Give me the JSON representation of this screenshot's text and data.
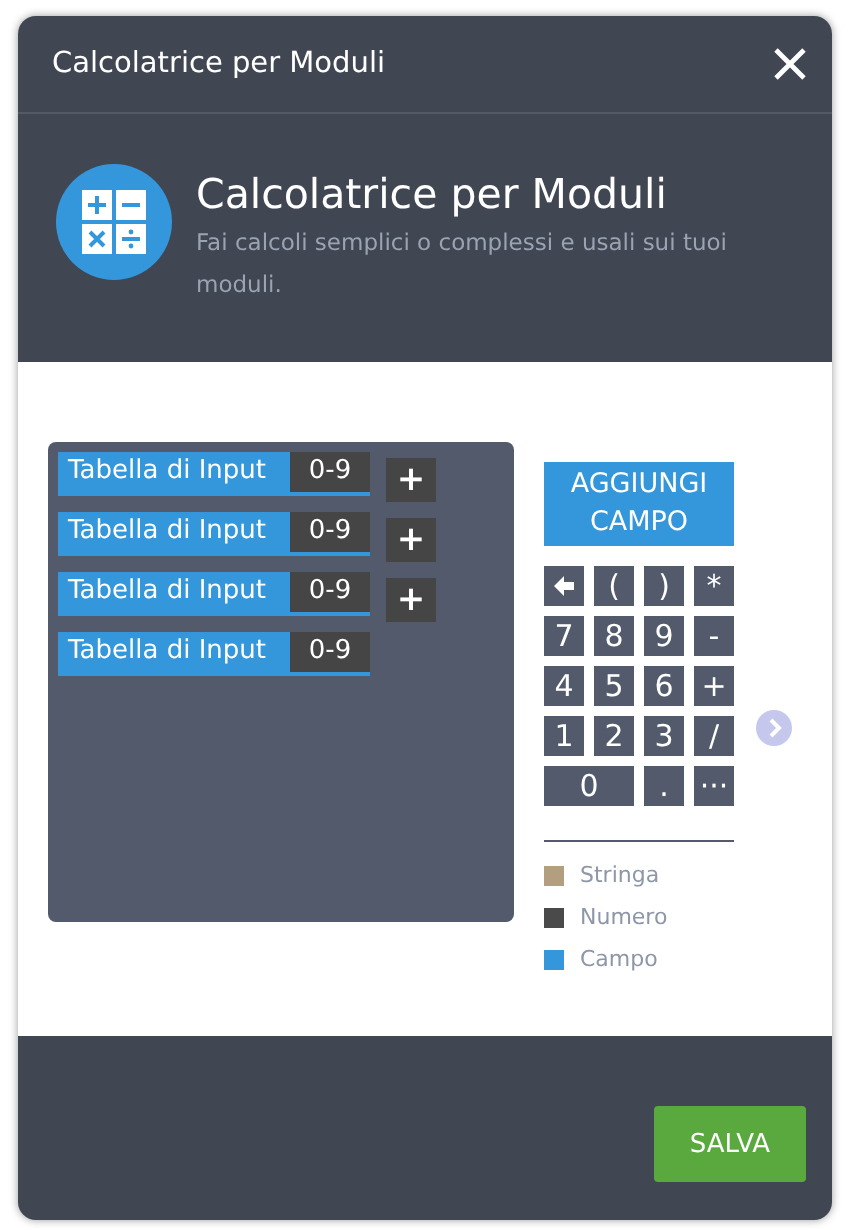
{
  "window": {
    "title": "Calcolatrice per Moduli"
  },
  "hero": {
    "title": "Calcolatrice per Moduli",
    "subtitle": "Fai calcoli semplici o complessi e usali sui tuoi moduli."
  },
  "inputs": [
    {
      "label": "Tabella di Input",
      "value": "0-9",
      "add": "+"
    },
    {
      "label": "Tabella di Input",
      "value": "0-9",
      "add": "+"
    },
    {
      "label": "Tabella di Input",
      "value": "0-9",
      "add": "+"
    },
    {
      "label": "Tabella di Input",
      "value": "0-9"
    }
  ],
  "add_field_button": "AGGIUNGI CAMPO",
  "keys": [
    {
      "kind": "backspace"
    },
    {
      "kind": "key",
      "label": "("
    },
    {
      "kind": "key",
      "label": ")"
    },
    {
      "kind": "key",
      "label": "*"
    },
    {
      "kind": "key",
      "label": "7"
    },
    {
      "kind": "key",
      "label": "8"
    },
    {
      "kind": "key",
      "label": "9"
    },
    {
      "kind": "key",
      "label": "-"
    },
    {
      "kind": "key",
      "label": "4"
    },
    {
      "kind": "key",
      "label": "5"
    },
    {
      "kind": "key",
      "label": "6"
    },
    {
      "kind": "key",
      "label": "+"
    },
    {
      "kind": "key",
      "label": "1"
    },
    {
      "kind": "key",
      "label": "2"
    },
    {
      "kind": "key",
      "label": "3"
    },
    {
      "kind": "key",
      "label": "/"
    },
    {
      "kind": "wide",
      "label": "0"
    },
    {
      "kind": "key",
      "label": "."
    },
    {
      "kind": "key",
      "label": "···"
    }
  ],
  "legend": [
    {
      "label": "Stringa",
      "color": "#b49e80"
    },
    {
      "label": "Numero",
      "color": "#4a4a4a"
    },
    {
      "label": "Campo",
      "color": "#3497db"
    }
  ],
  "save_button": "SALVA"
}
